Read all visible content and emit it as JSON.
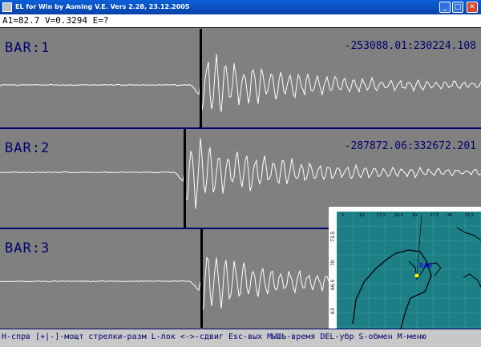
{
  "window": {
    "title": "EL for Win by Asming V.E. Vers 2.28, 23.12.2005",
    "minimize_glyph": "_",
    "maximize_glyph": "□",
    "close_glyph": "✕"
  },
  "info_line": "A1=82.7  V=0.3294  E=?",
  "panels": [
    {
      "label": "BAR:1",
      "range": "-253088.01:230224.108"
    },
    {
      "label": "BAR:2",
      "range": "-287872.06:332672.201"
    },
    {
      "label": "BAR:3",
      "range": ""
    }
  ],
  "map": {
    "station_label": "BAR",
    "lon_ticks": [
      "5",
      "10",
      "17.5",
      "22.5",
      "30",
      "37.5",
      "45",
      "52.5"
    ],
    "lat_ticks": [
      "73.5",
      "70",
      "66.5",
      "63"
    ],
    "ocean_color": "#1d7f86",
    "grid_color": "#7fd0d0",
    "station_marker_color": "#ffff00"
  },
  "footer_help": "H-спрв [+|-]-мощт стрелки-разм L-лок <->-сдвиг Esc-вых МЫШЬ-время DEL-убр S-обмен M-меню"
}
